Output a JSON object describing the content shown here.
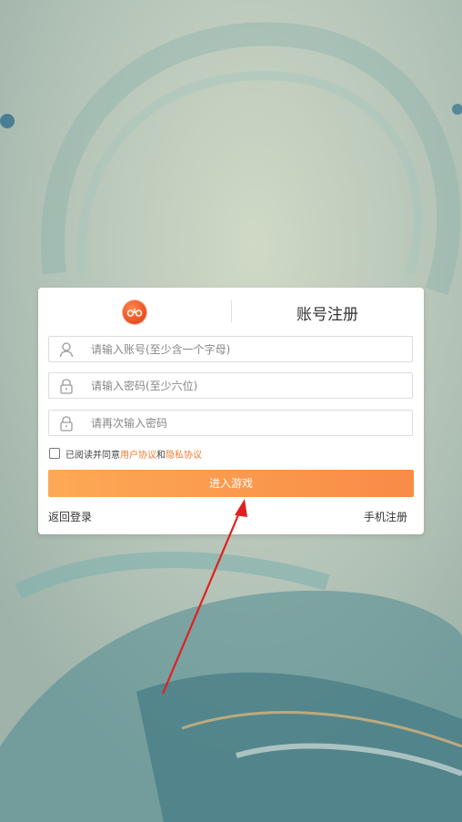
{
  "dialog": {
    "title": "账号注册",
    "account_placeholder": "请输入账号(至少含一个字母)",
    "password_placeholder": "请输入密码(至少六位)",
    "confirm_placeholder": "请再次输入密码",
    "agree_prefix": "已阅读并同意",
    "user_agreement": "用户协议",
    "agree_and": "和",
    "privacy_agreement": "隐私协议",
    "enter_game": "进入游戏",
    "back_login": "返回登录",
    "phone_register": "手机注册"
  },
  "colors": {
    "accent": "#f98b47",
    "link": "#f07b34",
    "arrow": "#e02020"
  },
  "icons": {
    "logo": "game-logo-icon",
    "account": "user-icon",
    "password": "lock-icon",
    "confirm": "lock-icon"
  }
}
